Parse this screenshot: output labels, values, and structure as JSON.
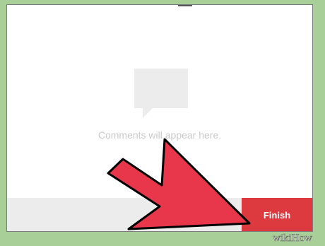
{
  "empty_state": {
    "message": "Comments will appear here.",
    "icon": "speech-bubble-icon"
  },
  "bottom_bar": {
    "finish_label": "Finish"
  },
  "overlay": {
    "arrow_icon": "red-arrow-icon",
    "watermark": "wikiHow"
  },
  "colors": {
    "background": "#a8cf98",
    "finish_button": "#dc3a3f",
    "arrow": "#e8364a",
    "bottom_bar": "#ececec",
    "placeholder_text": "#c9c9c9"
  }
}
